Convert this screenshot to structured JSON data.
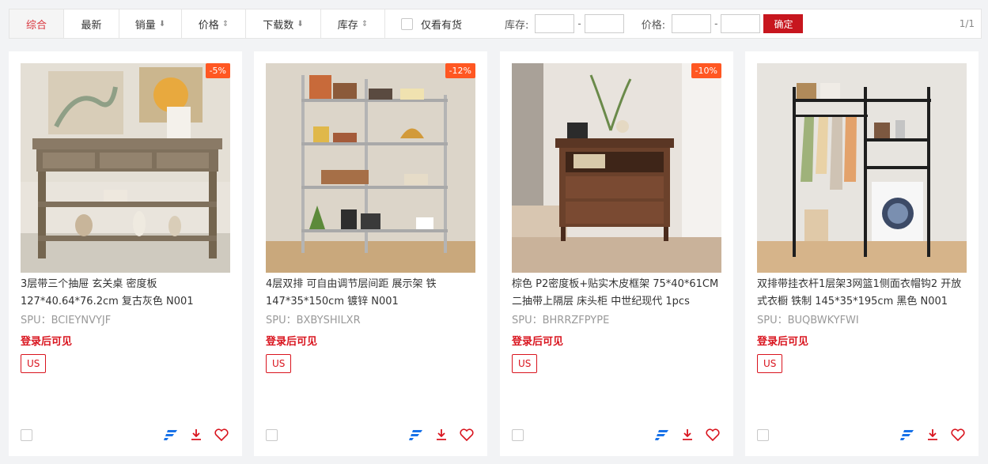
{
  "toolbar": {
    "sorts": [
      {
        "label": "综合",
        "arrow": ""
      },
      {
        "label": "最新",
        "arrow": ""
      },
      {
        "label": "销量",
        "arrow": "⬇"
      },
      {
        "label": "价格",
        "arrow": "⇕"
      },
      {
        "label": "下载数",
        "arrow": "⬇"
      },
      {
        "label": "库存",
        "arrow": "⇕"
      }
    ],
    "instock_label": "仅看有货",
    "stock_label": "库存:",
    "price_label": "价格:",
    "dash": "-",
    "confirm_label": "确定",
    "pager": "1/1"
  },
  "products": [
    {
      "discount": "-5%",
      "title": "3层带三个抽屉 玄关桌 密度板 127*40.64*76.2cm 复古灰色 N001",
      "spu": "SPU：BCIEYNVYJF",
      "login": "登录后可见",
      "tag": "US"
    },
    {
      "discount": "-12%",
      "title": "4层双排 可自由调节层间距 展示架 铁 147*35*150cm 镀锌 N001",
      "spu": "SPU：BXBYSHILXR",
      "login": "登录后可见",
      "tag": "US"
    },
    {
      "discount": "-10%",
      "title": "棕色 P2密度板+贴实木皮框架 75*40*61CM 二抽带上隔层 床头柜 中世纪现代 1pcs",
      "spu": "SPU：BHRRZFPYPE",
      "login": "登录后可见",
      "tag": "US"
    },
    {
      "discount": "",
      "title": "双排带挂衣杆1层架3网篮1侧面衣帽钩2 开放式衣橱 铁制 145*35*195cm 黑色 N001",
      "spu": "SPU：BUQBWKYFWI",
      "login": "登录后可见",
      "tag": "US"
    }
  ],
  "colors": {
    "accent": "#d9141e",
    "badge": "#ff5722",
    "flow_icon": "#1a73e8"
  }
}
